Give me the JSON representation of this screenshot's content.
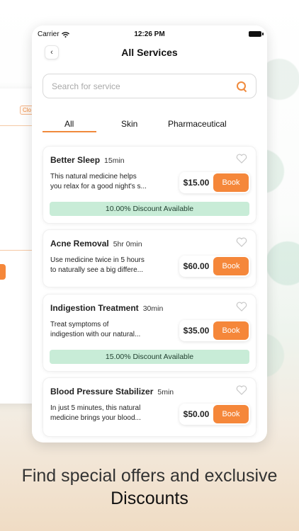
{
  "status_bar": {
    "carrier": "Carrier",
    "time": "12:26 PM"
  },
  "background_card": {
    "badge": "Clo"
  },
  "nav": {
    "title": "All Services"
  },
  "search": {
    "placeholder": "Search for service"
  },
  "tabs": [
    {
      "label": "All",
      "active": true
    },
    {
      "label": "Skin",
      "active": false
    },
    {
      "label": "Pharmaceutical",
      "active": false
    }
  ],
  "services": [
    {
      "name": "Better Sleep",
      "duration": "15min",
      "desc1": "This natural medicine helps",
      "desc2": "you relax for a good night's s...",
      "price": "$15.00",
      "book": "Book",
      "discount": "10.00% Discount Available"
    },
    {
      "name": "Acne Removal",
      "duration": "5hr 0min",
      "desc1": "Use medicine twice in 5 hours",
      "desc2": "to naturally see a big differe...",
      "price": "$60.00",
      "book": "Book",
      "discount": ""
    },
    {
      "name": "Indigestion Treatment",
      "duration": "30min",
      "desc1": "Treat symptoms of",
      "desc2": "indigestion with our natural...",
      "price": "$35.00",
      "book": "Book",
      "discount": "15.00% Discount Available"
    },
    {
      "name": "Blood Pressure Stabilizer",
      "duration": "5min",
      "desc1": "In just 5 minutes, this natural",
      "desc2": "medicine brings your blood...",
      "price": "$50.00",
      "book": "Book",
      "discount": ""
    }
  ],
  "tagline": {
    "line1": "Find special offers and exclusive",
    "line2": "Discounts"
  },
  "colors": {
    "accent": "#f5873a",
    "discount_bg": "#c8ecd7"
  }
}
